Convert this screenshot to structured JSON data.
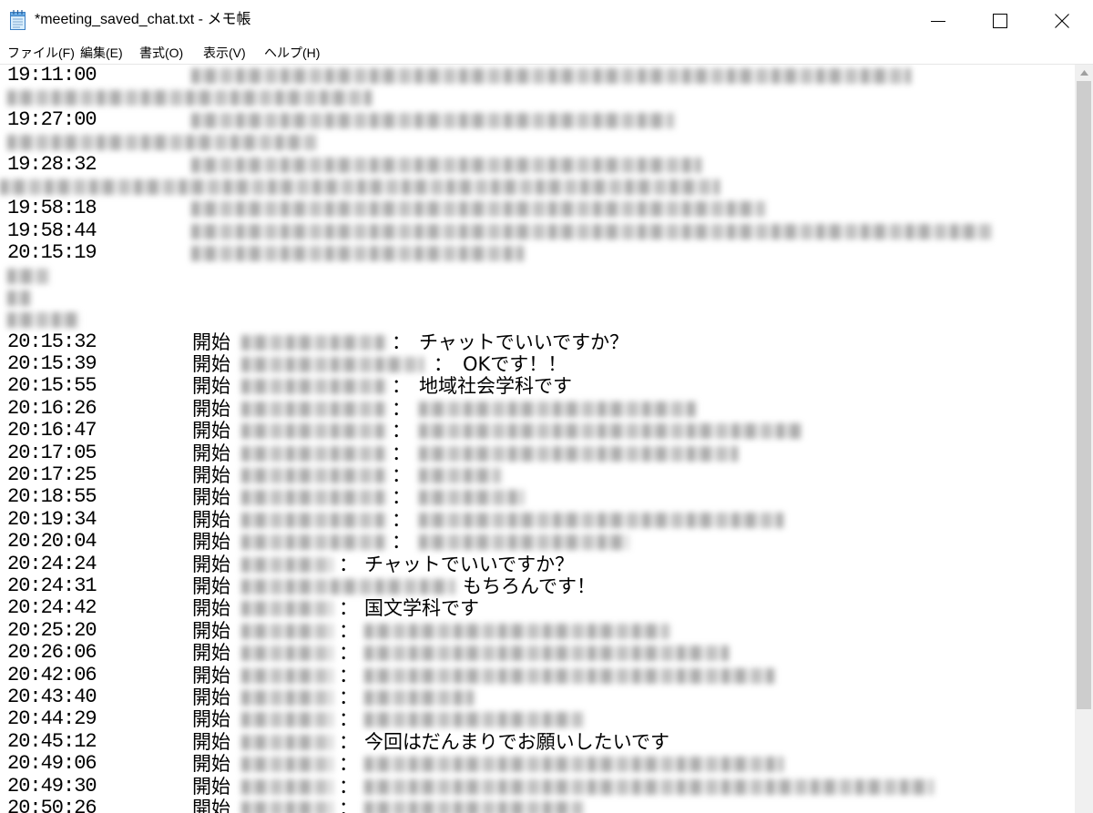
{
  "window": {
    "title": "*meeting_saved_chat.txt - メモ帳",
    "icon": "notepad-icon",
    "controls": {
      "minimize": "minimize-icon",
      "maximize": "maximize-icon",
      "close": "close-icon"
    }
  },
  "menu": {
    "items": [
      {
        "label": "ファイル(F)"
      },
      {
        "label": "編集(E)"
      },
      {
        "label": "書式(O)"
      },
      {
        "label": "表示(V)"
      },
      {
        "label": "ヘルプ(H)"
      }
    ]
  },
  "editor": {
    "lines": [
      {
        "time": "19:11:00"
      },
      {},
      {
        "time": "19:27:00"
      },
      {},
      {
        "time": "19:28:32"
      },
      {},
      {
        "time": "19:58:18"
      },
      {
        "time": "19:58:44"
      },
      {
        "time": "20:15:19"
      },
      {},
      {},
      {},
      {
        "time": "20:15:32",
        "action": "開始",
        "separator": "：",
        "message": "チャットでいいですか？"
      },
      {
        "time": "20:15:39",
        "action": "開始",
        "separator": "：",
        "message": "OKです！！"
      },
      {
        "time": "20:15:55",
        "action": "開始",
        "separator": "：",
        "message": "地域社会学科です"
      },
      {
        "time": "20:16:26",
        "action": "開始",
        "separator": "："
      },
      {
        "time": "20:16:47",
        "action": "開始",
        "separator": "："
      },
      {
        "time": "20:17:05",
        "action": "開始",
        "separator": "："
      },
      {
        "time": "20:17:25",
        "action": "開始",
        "separator": "："
      },
      {
        "time": "20:18:55",
        "action": "開始",
        "separator": "："
      },
      {
        "time": "20:19:34",
        "action": "開始",
        "separator": "："
      },
      {
        "time": "20:20:04",
        "action": "開始",
        "separator": "："
      },
      {
        "time": "20:24:24",
        "action": "開始",
        "separator": "：",
        "message": "チャットでいいですか？"
      },
      {
        "time": "20:24:31",
        "action": "開始",
        "message": "もちろんです！"
      },
      {
        "time": "20:24:42",
        "action": "開始",
        "separator": "：",
        "message": "国文学科です"
      },
      {
        "time": "20:25:20",
        "action": "開始",
        "separator": "："
      },
      {
        "time": "20:26:06",
        "action": "開始",
        "separator": "："
      },
      {
        "time": "20:42:06",
        "action": "開始",
        "separator": "："
      },
      {
        "time": "20:43:40",
        "action": "開始",
        "separator": "："
      },
      {
        "time": "20:44:29",
        "action": "開始",
        "separator": "："
      },
      {
        "time": "20:45:12",
        "action": "開始",
        "separator": "：",
        "message": "今回はだんまりでお願いしたいです"
      },
      {
        "time": "20:49:06",
        "action": "開始",
        "separator": "："
      },
      {
        "time": "20:49:30",
        "action": "開始",
        "separator": "："
      },
      {
        "time": "20:50:26",
        "action": "開始",
        "separator": "："
      }
    ]
  },
  "theme": {
    "background": "#ffffff",
    "text": "#000000",
    "scrollbar_track": "#f0f0f0",
    "scrollbar_thumb": "#cdcdcd"
  }
}
